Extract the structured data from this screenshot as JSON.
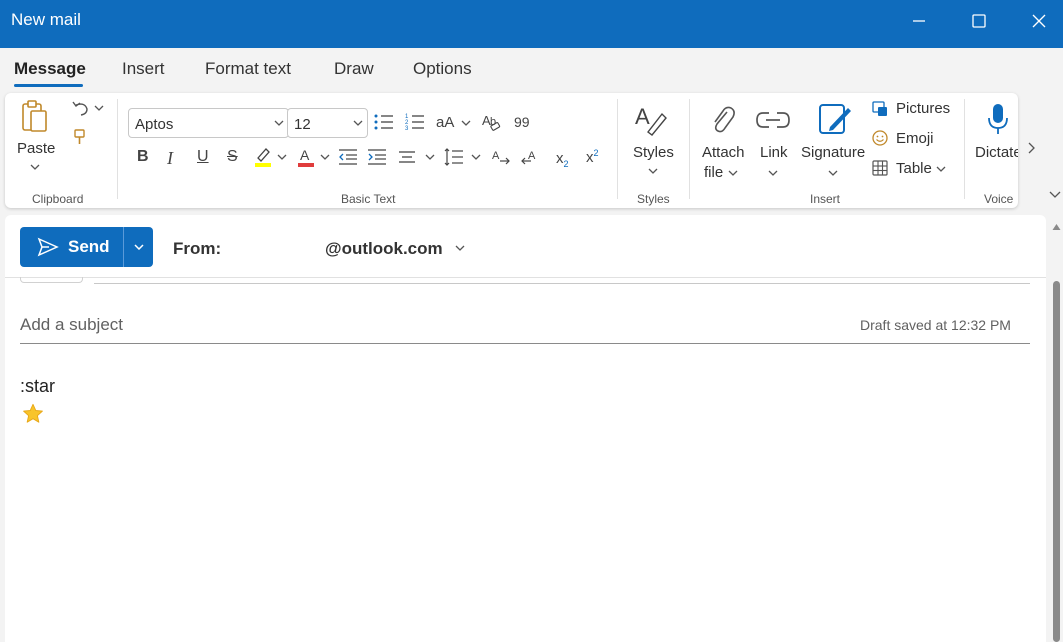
{
  "window": {
    "title": "New mail",
    "controls": [
      "minimize",
      "maximize",
      "close"
    ]
  },
  "tabs": [
    {
      "label": "Message",
      "active": true
    },
    {
      "label": "Insert",
      "active": false
    },
    {
      "label": "Format text",
      "active": false
    },
    {
      "label": "Draw",
      "active": false
    },
    {
      "label": "Options",
      "active": false
    }
  ],
  "ribbon": {
    "clipboard": {
      "paste_label": "Paste",
      "group_label": "Clipboard"
    },
    "basic_text": {
      "font": "Aptos",
      "size": "12",
      "group_label": "Basic Text",
      "format_buttons": {
        "bold": "B",
        "italic": "I",
        "underline": "U",
        "strike": "S",
        "font_size_toggle": "aA",
        "subscript": "x",
        "subscript_mark": "2",
        "superscript": "x",
        "superscript_mark": "2",
        "quote": "99"
      }
    },
    "styles": {
      "label": "Styles",
      "group_label": "Styles"
    },
    "insert": {
      "attach_line1": "Attach",
      "attach_line2": "file",
      "link": "Link",
      "signature": "Signature",
      "pictures": "Pictures",
      "emoji": "Emoji",
      "table": "Table",
      "group_label": "Insert"
    },
    "voice": {
      "dictate": "Dictate",
      "group_label": "Voice"
    }
  },
  "compose": {
    "send_label": "Send",
    "from_label": "From:",
    "from_value": "@outlook.com",
    "subject_placeholder": "Add a subject",
    "draft_status": "Draft saved at 12:32 PM",
    "body_text": ":star",
    "body_emoji": "star-emoji"
  },
  "colors": {
    "accent": "#0f6cbd",
    "highlight": "#ffff00",
    "font_color": "#e03c3c",
    "star": "#f8c42a"
  }
}
